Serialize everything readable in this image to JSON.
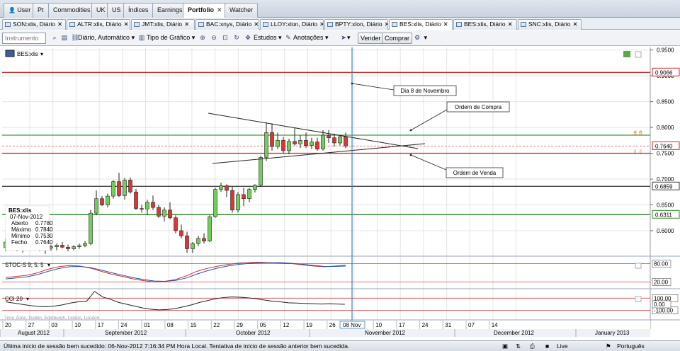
{
  "top_tabs": [
    "User",
    "Pt",
    "Commodities",
    "UK",
    "US",
    "Índices",
    "Earnings",
    "Portfolio",
    "Watcher"
  ],
  "active_top_tab": "Portfolio",
  "close_glyph": "✕",
  "instrument_tabs": [
    "SON:xlis, Diário",
    "ALTR:xlis, Diário",
    "JMT:xlis, Diário",
    "BAC:xnys, Diário",
    "LLOY:xlon, Diário",
    "BPTY:xlon, Diário",
    "BES:xlis, Diário",
    "BES:xlis, Diário",
    "SNC:xlis, Diário"
  ],
  "active_instrument_tab": 6,
  "toolbar": {
    "instrument_placeholder": "Instrumento",
    "interval": "Diário, Automático",
    "chart_type": "Tipo de Gráfico",
    "studies": "Estudos",
    "annotations": "Anotações",
    "sell": "Vender",
    "buy": "Comprar"
  },
  "chart": {
    "symbol": "BES:xlis",
    "info": {
      "title": "BES:xlis",
      "date": "07-Nov-2012",
      "rows": [
        [
          "Aberto",
          "0.7780"
        ],
        [
          "Máximo",
          "0.7840"
        ],
        [
          "Mínimo",
          "0.7530"
        ],
        [
          "Fecho",
          "0.7640"
        ]
      ]
    },
    "price_axis": [
      "0.9500",
      "0.9000",
      "0.8500",
      "0.8000",
      "0.7500",
      "0.7000",
      "0.6500",
      "0.6000"
    ],
    "price_axis_values": [
      0.95,
      0.9,
      0.85,
      0.8,
      0.75,
      0.7,
      0.65,
      0.6
    ],
    "markers": [
      {
        "value": 0.9066,
        "label": "0.9066",
        "color": "#cc2a2a"
      },
      {
        "value": 0.764,
        "label": "0.7640",
        "color": "#cc2a2a"
      },
      {
        "value": 0.6859,
        "label": "0.6859",
        "color": "#333333"
      },
      {
        "value": 0.6311,
        "label": "0.6311",
        "color": "#2d8a2d"
      }
    ],
    "hlines": [
      {
        "value": 0.9066,
        "color": "#cc2a2a"
      },
      {
        "value": 0.785,
        "color": "#3d9a3d"
      },
      {
        "value": 0.764,
        "color": "#e08080",
        "dash": true
      },
      {
        "value": 0.75,
        "color": "#cc2a2a"
      },
      {
        "value": 0.6859,
        "color": "#444444"
      },
      {
        "value": 0.6311,
        "color": "#2d8a2d"
      }
    ],
    "annotations": [
      "Dia 8 de Novembro",
      "Ordem de Compra",
      "Ordem de Venda"
    ],
    "candles": [
      [
        0.567,
        0.585,
        0.56,
        0.578
      ],
      [
        0.578,
        0.58,
        0.566,
        0.57
      ],
      [
        0.57,
        0.575,
        0.56,
        0.565
      ],
      [
        0.565,
        0.573,
        0.558,
        0.57
      ],
      [
        0.57,
        0.583,
        0.563,
        0.575
      ],
      [
        0.575,
        0.578,
        0.565,
        0.568
      ],
      [
        0.568,
        0.575,
        0.56,
        0.563
      ],
      [
        0.563,
        0.57,
        0.555,
        0.566
      ],
      [
        0.566,
        0.573,
        0.561,
        0.569
      ],
      [
        0.569,
        0.575,
        0.562,
        0.572
      ],
      [
        0.572,
        0.578,
        0.566,
        0.568
      ],
      [
        0.568,
        0.573,
        0.56,
        0.565
      ],
      [
        0.565,
        0.572,
        0.562,
        0.569
      ],
      [
        0.569,
        0.575,
        0.565,
        0.571
      ],
      [
        0.571,
        0.58,
        0.568,
        0.575
      ],
      [
        0.575,
        0.64,
        0.572,
        0.634
      ],
      [
        0.634,
        0.678,
        0.63,
        0.662
      ],
      [
        0.662,
        0.667,
        0.648,
        0.65
      ],
      [
        0.65,
        0.672,
        0.645,
        0.667
      ],
      [
        0.667,
        0.698,
        0.662,
        0.695
      ],
      [
        0.695,
        0.712,
        0.665,
        0.668
      ],
      [
        0.668,
        0.702,
        0.66,
        0.698
      ],
      [
        0.698,
        0.703,
        0.672,
        0.675
      ],
      [
        0.675,
        0.681,
        0.64,
        0.643
      ],
      [
        0.643,
        0.65,
        0.635,
        0.642
      ],
      [
        0.642,
        0.66,
        0.63,
        0.655
      ],
      [
        0.655,
        0.668,
        0.64,
        0.645
      ],
      [
        0.645,
        0.65,
        0.625,
        0.628
      ],
      [
        0.628,
        0.645,
        0.618,
        0.64
      ],
      [
        0.64,
        0.655,
        0.622,
        0.625
      ],
      [
        0.625,
        0.63,
        0.595,
        0.6
      ],
      [
        0.6,
        0.612,
        0.585,
        0.59
      ],
      [
        0.59,
        0.598,
        0.557,
        0.565
      ],
      [
        0.565,
        0.578,
        0.557,
        0.575
      ],
      [
        0.575,
        0.59,
        0.57,
        0.585
      ],
      [
        0.585,
        0.595,
        0.575,
        0.58
      ],
      [
        0.58,
        0.63,
        0.578,
        0.627
      ],
      [
        0.627,
        0.683,
        0.625,
        0.68
      ],
      [
        0.68,
        0.693,
        0.675,
        0.687
      ],
      [
        0.687,
        0.69,
        0.665,
        0.678
      ],
      [
        0.678,
        0.685,
        0.635,
        0.64
      ],
      [
        0.64,
        0.675,
        0.635,
        0.67
      ],
      [
        0.67,
        0.683,
        0.648,
        0.662
      ],
      [
        0.662,
        0.683,
        0.655,
        0.68
      ],
      [
        0.68,
        0.69,
        0.674,
        0.688
      ],
      [
        0.688,
        0.745,
        0.685,
        0.742
      ],
      [
        0.742,
        0.81,
        0.735,
        0.79
      ],
      [
        0.79,
        0.808,
        0.755,
        0.763
      ],
      [
        0.763,
        0.79,
        0.758,
        0.775
      ],
      [
        0.775,
        0.782,
        0.75,
        0.755
      ],
      [
        0.755,
        0.778,
        0.748,
        0.773
      ],
      [
        0.773,
        0.8,
        0.765,
        0.768
      ],
      [
        0.768,
        0.785,
        0.76,
        0.775
      ],
      [
        0.775,
        0.79,
        0.76,
        0.765
      ],
      [
        0.765,
        0.78,
        0.758,
        0.772
      ],
      [
        0.772,
        0.78,
        0.755,
        0.758
      ],
      [
        0.758,
        0.795,
        0.755,
        0.785
      ],
      [
        0.785,
        0.795,
        0.77,
        0.78
      ],
      [
        0.78,
        0.788,
        0.763,
        0.77
      ],
      [
        0.77,
        0.785,
        0.765,
        0.782
      ],
      [
        0.782,
        0.79,
        0.76,
        0.764
      ]
    ],
    "stoc": {
      "label": "STOC-S 9; 5; 5",
      "levels": [
        "80.00",
        "20.00"
      ],
      "level_values": [
        80,
        20
      ],
      "k": [
        35,
        38,
        42,
        50,
        62,
        70,
        74,
        72,
        65,
        55,
        45,
        38,
        30,
        24,
        20,
        22,
        28,
        40,
        55,
        65,
        72,
        78,
        82,
        84,
        85,
        84,
        82,
        80,
        76,
        72,
        70,
        72,
        75
      ],
      "d": [
        30,
        33,
        37,
        44,
        55,
        64,
        70,
        71,
        67,
        59,
        50,
        42,
        34,
        28,
        23,
        22,
        25,
        33,
        46,
        57,
        66,
        73,
        78,
        81,
        83,
        84,
        83,
        81,
        78,
        74,
        71,
        71,
        72
      ]
    },
    "cci": {
      "label": "CCI 20",
      "levels": [
        "100.00",
        "-100.00"
      ],
      "level_values": [
        100,
        -100
      ],
      "current_value": "0.00",
      "values": [
        40,
        20,
        0,
        -20,
        -35,
        -40,
        -30,
        -10,
        20,
        40,
        45,
        210,
        120,
        80,
        30,
        0,
        -30,
        -60,
        -80,
        -90,
        -85,
        -70,
        -40,
        -10,
        30,
        60,
        90,
        110,
        120,
        115,
        105,
        90,
        70,
        50,
        40,
        25,
        20,
        15,
        10,
        5,
        8,
        5,
        0
      ]
    },
    "timezone": "Time Zone: Dublin, Edinburgh, Lisbon, London",
    "days": [
      "20",
      "27",
      "03",
      "10",
      "17",
      "24",
      "01",
      "08",
      "15",
      "22",
      "29",
      "05",
      "12",
      "19",
      "26",
      "03",
      "10",
      "17",
      "24",
      "31",
      "07",
      "14"
    ],
    "months": [
      "August 2012",
      "September 2012",
      "October 2012",
      "November 2012",
      "December 2012",
      "January 2013"
    ],
    "cursor_date": "08 Nov"
  },
  "status": {
    "message": "Última início de sessão bem sucedido: 06-Nov-2012 7:16:34 PM Hora Local. Tentativa de início de sessão anterior bem sucedida.",
    "live": "Live",
    "language": "Português"
  }
}
